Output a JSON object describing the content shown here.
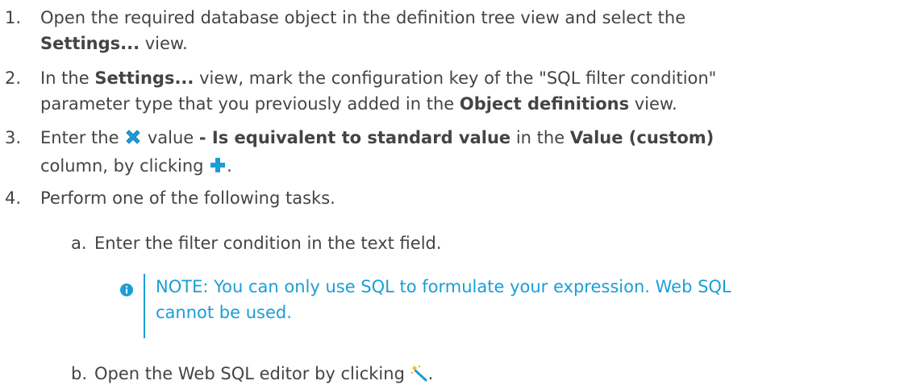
{
  "steps": [
    {
      "num": "1.",
      "line1": "Open the required database object in the definition tree view and select the",
      "bold1": "Settings...",
      "tail1": " view."
    },
    {
      "num": "2.",
      "pre": "In the ",
      "bold1": "Settings...",
      "mid": " view, mark the configuration key of the \"SQL filter condition\"",
      "line2pre": "parameter type that you previously added in the ",
      "bold2": "Object definitions",
      "tail": " view."
    },
    {
      "num": "3.",
      "pre": "Enter the ",
      "mid": " value ",
      "bold1": "- Is equivalent to standard value",
      "mid2": " in the ",
      "bold2": "Value (custom)",
      "line2": "column, by clicking ",
      "end": "."
    },
    {
      "num": "4.",
      "text": "Perform one of the following tasks."
    }
  ],
  "substeps": [
    {
      "num": "a.",
      "text": "Enter the filter condition in the text field."
    },
    {
      "num": "b.",
      "pre": "Open the Web SQL editor by clicking ",
      "end": "."
    }
  ],
  "note": {
    "line1": "NOTE: You can only use SQL to formulate your expression. Web SQL",
    "line2": "cannot be used."
  },
  "icons": {
    "delete": "x-cross-icon",
    "add": "plus-icon",
    "wizard": "magic-wand-icon",
    "info": "info-icon"
  },
  "colors": {
    "text": "#444444",
    "accent": "#1a9ed6"
  }
}
